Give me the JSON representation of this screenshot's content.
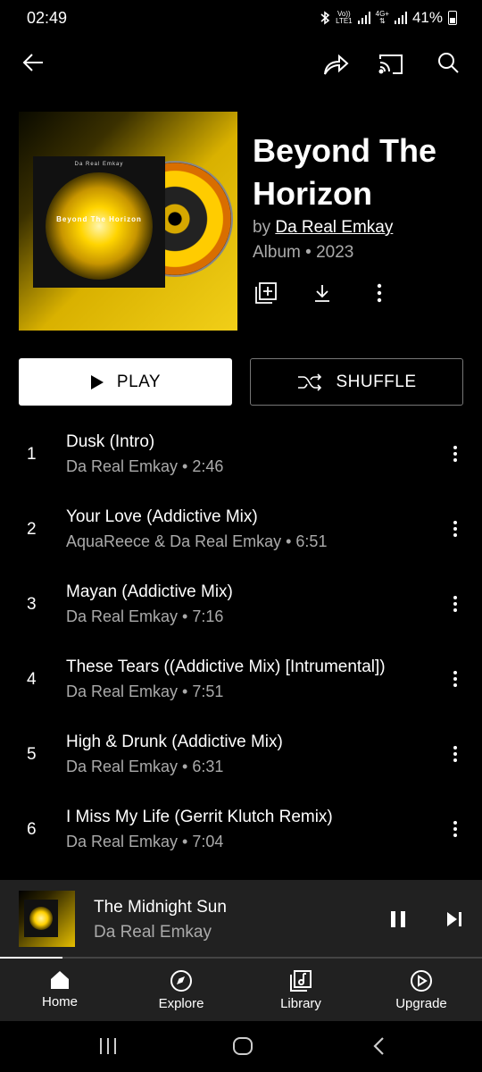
{
  "status": {
    "time": "02:49",
    "network_top": "Vo))",
    "network_bottom": "LTE1",
    "network2_top": "4G+",
    "battery": "41%"
  },
  "icons": {
    "back": "back-arrow-icon",
    "share": "share-icon",
    "cast": "cast-icon",
    "search": "search-icon",
    "add_to_library": "add-to-library-icon",
    "download": "download-icon",
    "more": "more-vert-icon",
    "play": "play-icon",
    "shuffle": "shuffle-icon",
    "pause": "pause-icon",
    "next": "skip-next-icon"
  },
  "album": {
    "title": "Beyond The Horizon",
    "by_prefix": "by",
    "artist": "Da Real Emkay",
    "meta": "Album • 2023",
    "cover_artist_text": "Da Real Emkay",
    "cover_title_text": "Beyond The Horizon"
  },
  "actions": {
    "play_label": "PLAY",
    "shuffle_label": "SHUFFLE"
  },
  "tracks": [
    {
      "num": "1",
      "title": "Dusk (Intro)",
      "subtitle": "Da Real Emkay • 2:46"
    },
    {
      "num": "2",
      "title": "Your Love (Addictive Mix)",
      "subtitle": "AquaReece & Da Real Emkay • 6:51"
    },
    {
      "num": "3",
      "title": "Mayan (Addictive Mix)",
      "subtitle": "Da Real Emkay • 7:16"
    },
    {
      "num": "4",
      "title": "These Tears ((Addictive Mix) [Intrumental])",
      "subtitle": "Da Real Emkay • 7:51"
    },
    {
      "num": "5",
      "title": "High & Drunk (Addictive Mix)",
      "subtitle": "Da Real Emkay • 6:31"
    },
    {
      "num": "6",
      "title": "I Miss My Life (Gerrit Klutch Remix)",
      "subtitle": "Da Real Emkay • 7:04"
    }
  ],
  "now_playing": {
    "title": "The Midnight Sun",
    "artist": "Da Real Emkay",
    "progress": 0.13
  },
  "nav": [
    {
      "label": "Home",
      "icon": "home-icon",
      "active": true
    },
    {
      "label": "Explore",
      "icon": "compass-icon",
      "active": false
    },
    {
      "label": "Library",
      "icon": "library-icon",
      "active": false
    },
    {
      "label": "Upgrade",
      "icon": "upgrade-icon",
      "active": false
    }
  ],
  "system_nav": {
    "recents": "recents-icon",
    "home": "system-home-icon",
    "back": "system-back-icon"
  },
  "colors": {
    "background": "#000000",
    "surface": "#212121",
    "muted_text": "#aaaaaa",
    "accent_cover": "#f1cf18"
  }
}
